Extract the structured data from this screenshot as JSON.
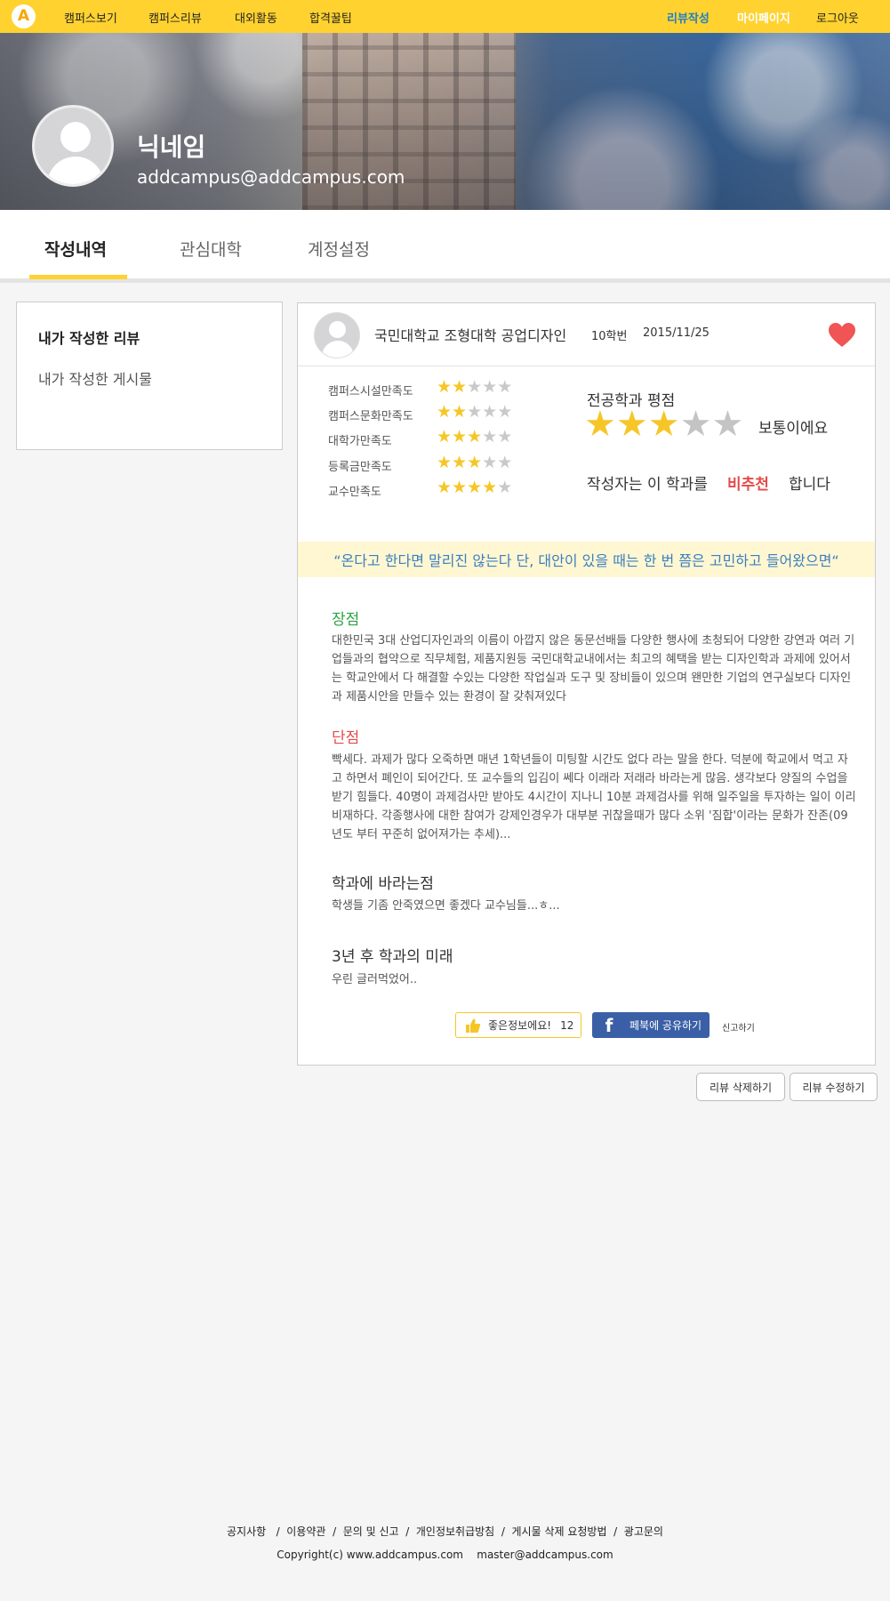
{
  "nav": {
    "logo": "A",
    "left": [
      "캠퍼스보기",
      "캠퍼스리뷰",
      "대외활동",
      "합격꿀팁"
    ],
    "write_review": "리뷰작성",
    "mypage": "마이페이지",
    "logout": "로그아웃",
    "colors": {
      "bar": "#ffd230",
      "write_review": "#1f7fc4",
      "mypage": "#ffffff"
    }
  },
  "profile": {
    "nickname": "닉네임",
    "email": "addcampus@addcampus.com"
  },
  "tabs": [
    {
      "label": "작성내역",
      "active": true
    },
    {
      "label": "관심대학",
      "active": false
    },
    {
      "label": "계정설정",
      "active": false
    }
  ],
  "sidebar": {
    "items": [
      {
        "label": "내가 작성한 리뷰",
        "active": true
      },
      {
        "label": "내가 작성한 게시물",
        "active": false
      }
    ]
  },
  "review": {
    "school": "국민대학교 조형대학 공업디자인",
    "class_year": "10학번",
    "date": "2015/11/25",
    "liked": true,
    "ratings": [
      {
        "label": "캠퍼스시설만족도",
        "stars": 2,
        "max": 5
      },
      {
        "label": "캠퍼스문화만족도",
        "stars": 2,
        "max": 5
      },
      {
        "label": "대학가만족도",
        "stars": 3,
        "max": 5
      },
      {
        "label": "등록금만족도",
        "stars": 3,
        "max": 5
      },
      {
        "label": "교수만족도",
        "stars": 4,
        "max": 5
      }
    ],
    "major": {
      "title": "전공학과 평점",
      "stars": 3,
      "max": 5,
      "verdict": "보통이에요"
    },
    "recommend": {
      "prefix": "작성자는 이 학과를",
      "word": "비추천",
      "suffix": "합니다"
    },
    "quote": "“온다고 한다면 말리진 않는다 단, 대안이 있을 때는 한 번 쯤은 고민하고 들어왔으면“",
    "pros_title": "장점",
    "pros": " 대한민국 3대 산업디자인과의 이름이 아깝지 않은 동문선배들 다양한 행사에 초청되어 다양한 강연과 여러 기업들과의 협약으로 직무체험, 제품지원등 국민대학교내에서는 최고의 혜택을 받는 디자인학과 과제에 있어서는 학교안에서 다 해결할 수있는 다양한 작업실과 도구 및 장비들이 있으며 왠만한 기업의 연구실보다 디자인과 제품시안을 만들수 있는 환경이 잘 갖춰져있다",
    "cons_title": "단점",
    "cons": " 빡세다. 과제가 많다 오죽하면 매년 1학년들이 미팅할 시간도 없다 라는 말을 한다. 덕분에 학교에서 먹고 자고 하면서 폐인이 되어간다. 또 교수들의 입김이 쎄다 이래라 저래라 바라는게 많음. 생각보다 양질의 수업을 받기 힘들다. 40명이 과제검사만 받아도 4시간이 지나니 10분 과제검사를 위해 일주일을 투자하는 일이 이리비재하다. 각종행사에 대한 참여가 강제인경우가 대부분 귀찮을때가 많다 소위 '짐합'이라는 문화가 잔존(09년도 부터 꾸준히 없어져가는 추세)...",
    "wish_title": "학과에 바라는점",
    "wish": "학생들 기좀 안죽였으면 좋겠다 교수님들...ㅎ...",
    "future_title": "3년 후 학과의 미래",
    "future": "우린 글러먹었어..",
    "like_label": "좋은정보에요!",
    "like_count": "12",
    "share_label": "페북에 공유하기",
    "report_label": "신고하기"
  },
  "actions": {
    "delete": "리뷰 삭제하기",
    "edit": "리뷰 수정하기"
  },
  "footer": {
    "links": "공지사항   /  이용약관  /  문의 및 신고  /  개인정보취급방침  /  게시물 삭제 요청방법  /  광고문의",
    "copyright": "Copyright(c) www.addcampus.com    master@addcampus.com"
  }
}
